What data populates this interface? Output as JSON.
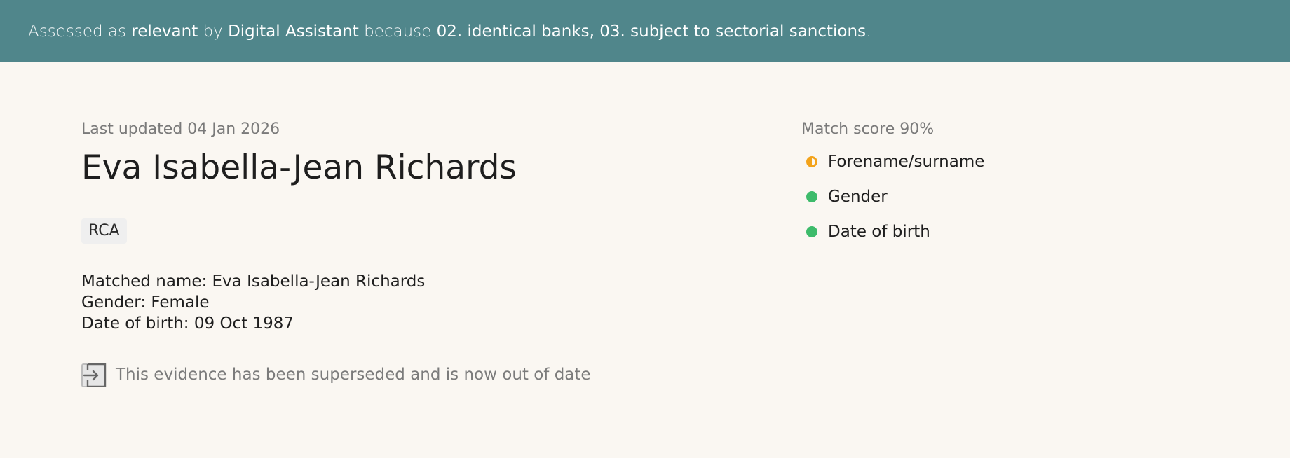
{
  "banner": {
    "prefix": "Assessed as",
    "status": "relevant",
    "by_word": "by",
    "assessor": "Digital Assistant",
    "because_word": "because",
    "reasons": "02. identical banks, 03. subject to sectorial sanctions",
    "end": ".",
    "background_color": "#50868b"
  },
  "profile": {
    "last_updated": "Last updated 04 Jan 2026",
    "name": "Eva Isabella-Jean Richards",
    "tag": "RCA",
    "matched_name": "Matched name: Eva Isabella-Jean Richards",
    "gender": "Gender: Female",
    "date_of_birth": "Date of birth: 09 Oct 1987",
    "superseded_notice": "This evidence has been superseded and is now out of date",
    "superseded_icon": "exit-arrow-icon"
  },
  "match": {
    "score_label": "Match score 90%",
    "criteria": [
      {
        "label": "Forename/surname",
        "status": "partial",
        "color": "#f3a31b"
      },
      {
        "label": "Gender",
        "status": "full",
        "color": "#3dbb6b"
      },
      {
        "label": "Date of birth",
        "status": "full",
        "color": "#3dbb6b"
      }
    ]
  }
}
